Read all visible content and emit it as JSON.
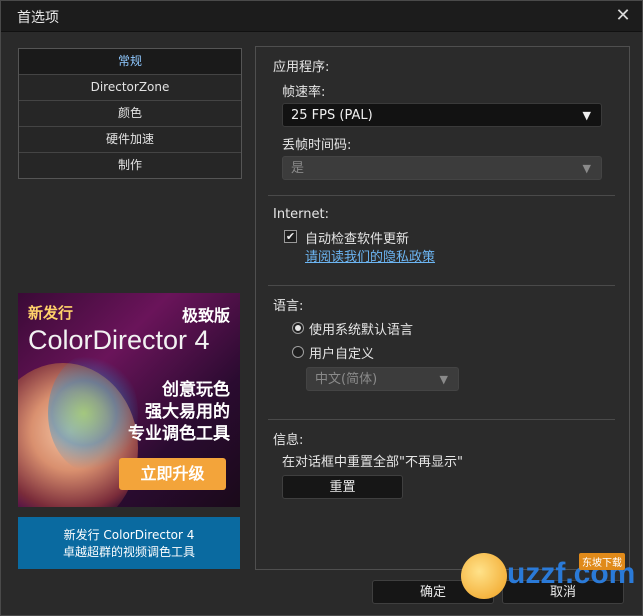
{
  "window": {
    "title": "首选项",
    "close_symbol": "✕"
  },
  "nav": {
    "items": [
      {
        "label": "常规",
        "active": true
      },
      {
        "label": "DirectorZone",
        "active": false
      },
      {
        "label": "颜色",
        "active": false
      },
      {
        "label": "硬件加速",
        "active": false
      },
      {
        "label": "制作",
        "active": false
      }
    ]
  },
  "ad": {
    "new_release": "新发行",
    "edition": "极致版",
    "product": "ColorDirector 4",
    "line1": "创意玩色",
    "line2": "强大易用的",
    "line3": "专业调色工具",
    "upgrade_label": "立即升级"
  },
  "promo": {
    "line1": "新发行  ColorDirector 4",
    "line2": "卓越超群的视频调色工具"
  },
  "app": {
    "section_label": "应用程序:",
    "framerate_label": "帧速率:",
    "framerate_value": "25 FPS (PAL)",
    "dropframe_label": "丢帧时间码:",
    "dropframe_value": "是"
  },
  "internet": {
    "section_label": "Internet:",
    "auto_check_label": "自动检查软件更新",
    "auto_check_checked": true,
    "privacy_link": "请阅读我们的隐私政策"
  },
  "language": {
    "section_label": "语言:",
    "option_default": "使用系统默认语言",
    "option_custom": "用户自定义",
    "selected": "default",
    "custom_value": "中文(简体)"
  },
  "info": {
    "section_label": "信息:",
    "reset_text": "在对话框中重置全部\"不再显示\"",
    "reset_button": "重置"
  },
  "footer": {
    "ok_label": "确定",
    "cancel_label": "取消"
  },
  "watermark": {
    "text": "uzzf.com",
    "badge": "东坡下载"
  },
  "colors": {
    "accent": "#6cb5f2",
    "nav_active_text": "#8fc8ff",
    "upgrade_button": "#f3a43a",
    "promo_bg": "#0a6aa0"
  }
}
